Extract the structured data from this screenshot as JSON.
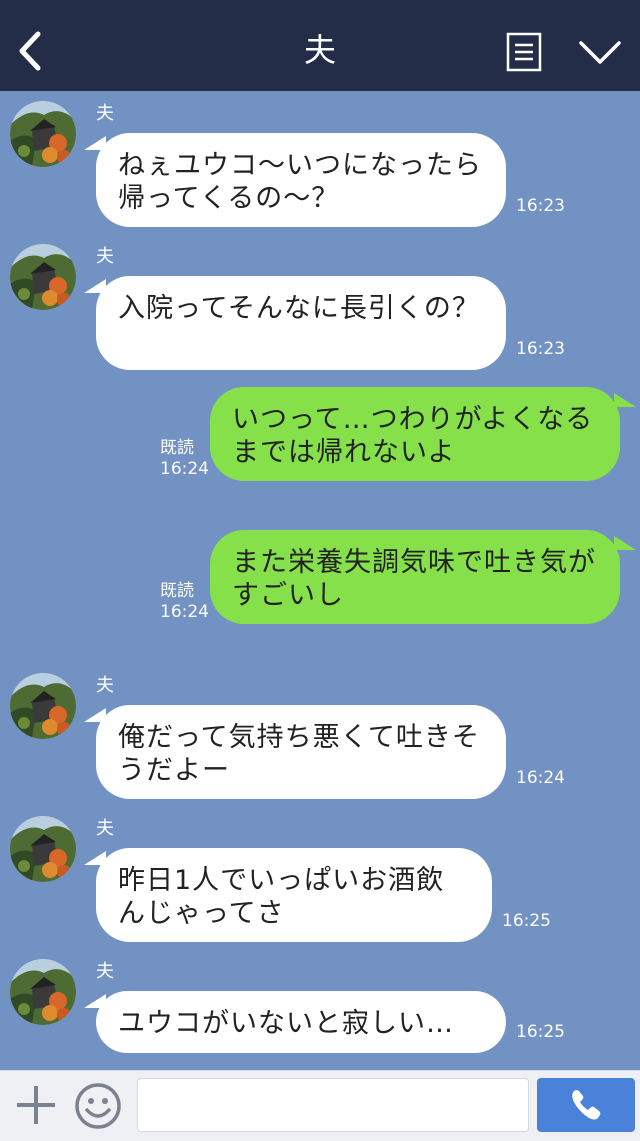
{
  "header": {
    "title": "夫",
    "back_icon": "chevron-left-icon",
    "menu_icon": "list-icon",
    "collapse_icon": "chevron-down-icon"
  },
  "messages": [
    {
      "side": "in",
      "sender": "夫",
      "text": "ねぇユウコ〜いつになったら帰ってくるの〜？",
      "time": "16:23"
    },
    {
      "side": "in",
      "sender": "夫",
      "text": "入院ってそんなに長引くの？",
      "time": "16:23"
    },
    {
      "side": "out",
      "read": "既読",
      "text": "いつって…つわりがよくなるまでは帰れないよ",
      "time": "16:24"
    },
    {
      "side": "out",
      "read": "既読",
      "text": "また栄養失調気味で吐き気がすごいし",
      "time": "16:24"
    },
    {
      "side": "in",
      "sender": "夫",
      "text": "俺だって気持ち悪くて吐きそうだよー",
      "time": "16:24"
    },
    {
      "side": "in",
      "sender": "夫",
      "text": "昨日1人でいっぱいお酒飲んじゃってさ",
      "time": "16:25"
    },
    {
      "side": "in",
      "sender": "夫",
      "text": "ユウコがいないと寂しい…",
      "time": "16:25"
    }
  ],
  "input": {
    "value": "",
    "placeholder": ""
  },
  "colors": {
    "header_bg": "#232d47",
    "chat_bg": "#7292c3",
    "outgoing_bubble": "#86e04a",
    "call_button": "#4b82d9"
  },
  "bottom_icons": [
    "plus-icon",
    "smiley-icon",
    "phone-icon"
  ]
}
